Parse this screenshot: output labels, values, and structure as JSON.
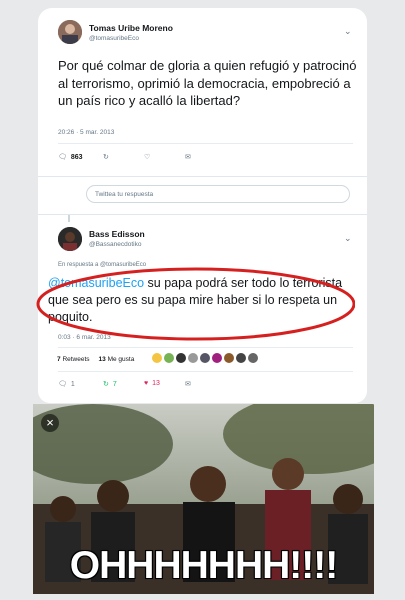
{
  "tweet1": {
    "name": "Tomas Uribe Moreno",
    "handle": "@tomasuribeEco",
    "text": "Por qué colmar de gloria a quien refugió y patrocinó al terrorismo, oprimió la democracia, empobreció a un país rico y acalló la libertad?",
    "timestamp": "20:26 · 5 mar. 2013",
    "replies": "863",
    "icons": [
      "reply-icon",
      "retweet-icon",
      "like-icon",
      "direct-message-icon",
      "chevron-down-icon"
    ]
  },
  "reply_box": {
    "placeholder": "Twittea tu respuesta"
  },
  "tweet2": {
    "name": "Bass Edisson",
    "handle": "@Bassanecdotiko",
    "reply_context": "En respuesta a @tomasuribeEco",
    "mention": "@tomasuribeEco",
    "text": " su papa podrá ser todo lo terrorista que sea pero es su papa mire haber si lo respeta un poquito.",
    "timestamp": "0:03 · 6 mar. 2013",
    "retweets_count": "7",
    "retweets_label": "Retweets",
    "likes_count": "13",
    "likes_label": "Me gusta",
    "action_replies": "1",
    "action_retweets": "7",
    "action_likes": "13",
    "highlight_color": "#d62020",
    "like_color": "#e0245e",
    "retweet_color": "#17bf63"
  },
  "meme": {
    "caption": "OHHHHHHH!!!!"
  }
}
